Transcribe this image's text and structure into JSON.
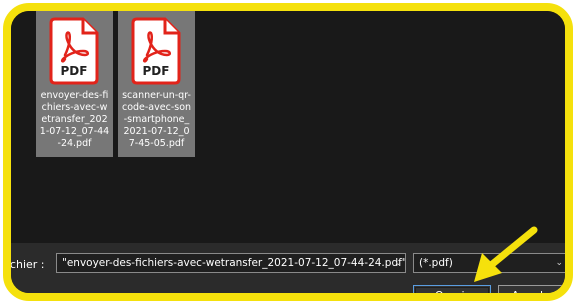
{
  "files": [
    {
      "icon": "pdf-file-icon",
      "badge": "PDF",
      "name": "envoyer-des-fichiers-avec-wetransfer_2021-07-12_07-44-24.pdf"
    },
    {
      "icon": "pdf-file-icon",
      "badge": "PDF",
      "name": "scanner-un-qr-code-avec-son-smartphone_2021-07-12_07-45-05.pdf"
    }
  ],
  "footer": {
    "filename_label": "fichier :",
    "filename_value": "\"envoyer-des-fichiers-avec-wetransfer_2021-07-12_07-44-24.pdf\" \"scanner-ur",
    "filetype_value": "(*.pdf)",
    "open_label": "Ouvrir",
    "cancel_label": "Annuler"
  },
  "colors": {
    "highlight_frame": "#f5e10c",
    "arrow": "#f5e10c",
    "pdf_red": "#e2231a",
    "selection_tile": "#777777",
    "background": "#191919"
  }
}
